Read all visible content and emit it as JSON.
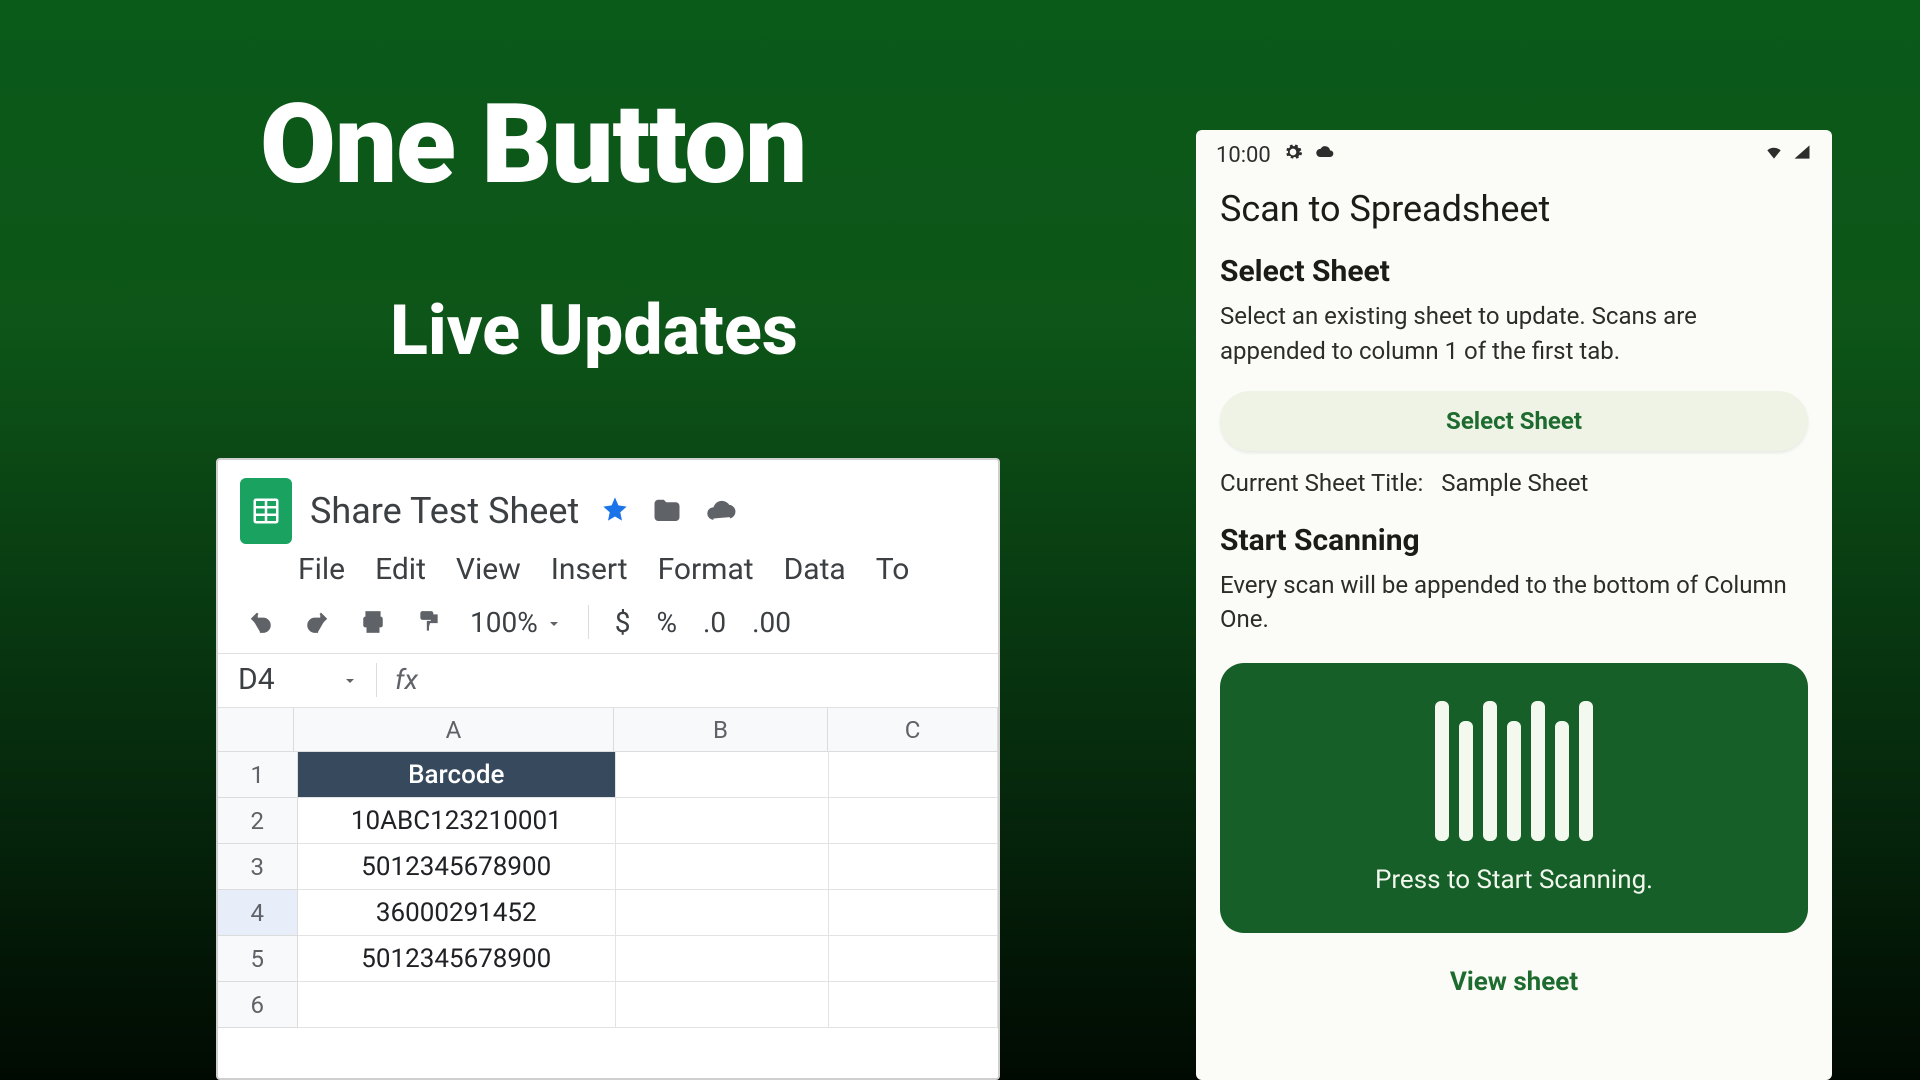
{
  "headings": {
    "line1": "One Button",
    "line2": "Live Updates"
  },
  "sheets": {
    "doc_title": "Share Test Sheet",
    "menu": [
      "File",
      "Edit",
      "View",
      "Insert",
      "Format",
      "Data",
      "To"
    ],
    "zoom": "100%",
    "toolbar_symbols": {
      "currency": "$",
      "percent": "%",
      "decrease_decimal": ".0",
      "increase_decimal": ".00"
    },
    "cell_ref": "D4",
    "fx_label": "fx",
    "columns": [
      "A",
      "B",
      "C"
    ],
    "rows": [
      {
        "num": "1",
        "a": "Barcode",
        "header": true
      },
      {
        "num": "2",
        "a": "10ABC123210001"
      },
      {
        "num": "3",
        "a": "5012345678900"
      },
      {
        "num": "4",
        "a": "36000291452",
        "selected": true
      },
      {
        "num": "5",
        "a": "5012345678900"
      },
      {
        "num": "6",
        "a": ""
      }
    ]
  },
  "phone": {
    "status_time": "10:00",
    "app_title": "Scan to Spreadsheet",
    "select_title": "Select Sheet",
    "select_desc": "Select an existing sheet to update. Scans are appended to column 1 of the first tab.",
    "select_button": "Select Sheet",
    "current_label": "Current Sheet Title:",
    "current_value": "Sample Sheet",
    "scan_title": "Start Scanning",
    "scan_desc": "Every scan will be appended to the bottom of Column One.",
    "scan_caption": "Press to Start Scanning.",
    "view_sheet": "View sheet"
  }
}
